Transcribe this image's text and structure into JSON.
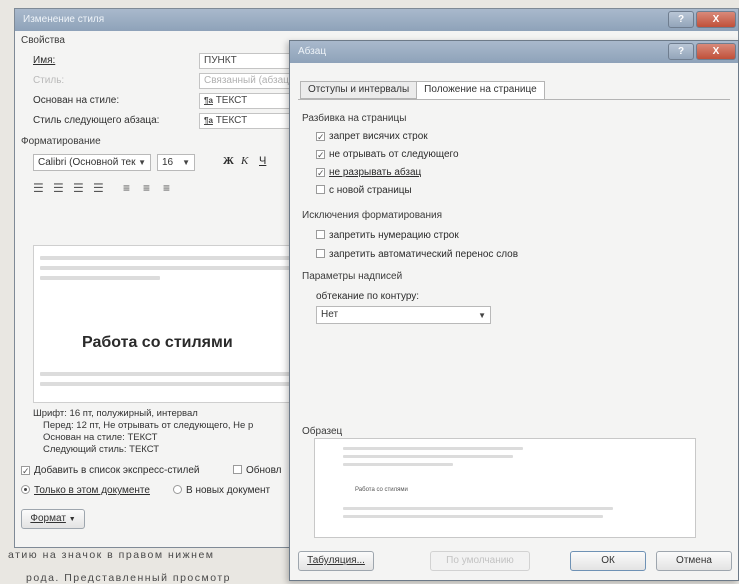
{
  "style_dialog": {
    "title": "Изменение стиля",
    "properties_header": "Свойства",
    "name_label": "Имя:",
    "name_value": "ПУНКТ",
    "style_label": "Стиль:",
    "style_value": "Связанный (абзац",
    "based_on_label": "Основан на стиле:",
    "based_on_value": "ТЕКСТ",
    "next_style_label": "Стиль следующего абзаца:",
    "next_style_value": "ТЕКСТ",
    "formatting_header": "Форматирование",
    "font_value": "Calibri (Основной тек",
    "size_value": "16",
    "bold_glyph": "Ж",
    "italic_glyph": "К",
    "underline_glyph": "Ч",
    "preview_heading": "Работа со стилями",
    "description": [
      "Шрифт: 16 пт, полужирный, интервал",
      "Перед: 12 пт, Не отрывать от следующего, Не р",
      "Основан на стиле: ТЕКСТ",
      "Следующий стиль: ТЕКСТ"
    ],
    "add_quick_styles": "Добавить в список экспресс-стилей",
    "auto_update": "Обновл",
    "only_this_doc": "Только в этом документе",
    "new_docs": "В новых документ",
    "format_button": "Формат"
  },
  "para_dialog": {
    "title": "Абзац",
    "tabs": [
      "Отступы и интервалы",
      "Положение на странице"
    ],
    "pagination_header": "Разбивка на страницы",
    "widow_control": "запрет висячих строк",
    "keep_with_next": "не отрывать от следующего",
    "keep_lines": "не разрывать абзац",
    "page_break_before": "с новой страницы",
    "exceptions_header": "Исключения форматирования",
    "suppress_numbers": "запретить нумерацию строк",
    "no_hyphenation": "запретить автоматический перенос слов",
    "textbox_header": "Параметры надписей",
    "wrap_label": "обтекание по контуру:",
    "wrap_value": "Нет",
    "sample_header": "Образец",
    "sample_heading": "Работа со стилями",
    "tabs_button": "Табуляция...",
    "default_button": "По умолчанию",
    "ok_button": "ОК",
    "cancel_button": "Отмена"
  },
  "titlebar_buttons": {
    "help": "?",
    "close": "X"
  },
  "background_text": {
    "line1": "атию на значок в правом нижнем",
    "line2": "рода. Представленный просмотр"
  }
}
